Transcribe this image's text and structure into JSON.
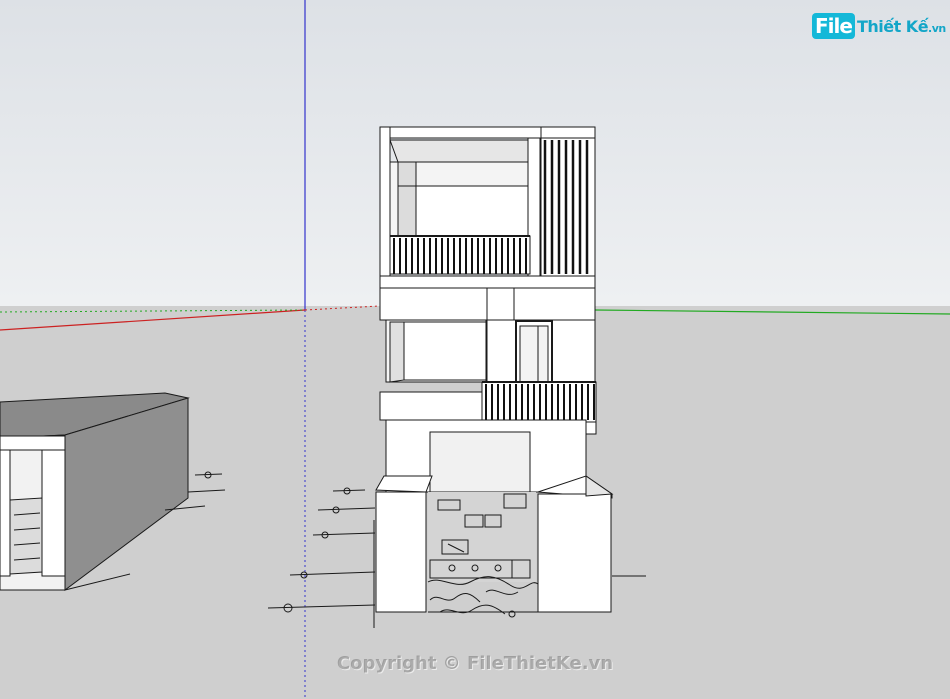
{
  "logo": {
    "prefix": "File",
    "name": "Thiết Kế",
    "suffix": ".vn"
  },
  "watermark": {
    "text": "Copyright © FileThietKe.vn"
  },
  "colors": {
    "sky_top": "#dde1e6",
    "sky_bottom": "#eef0f2",
    "ground": "#cfcfcf",
    "axis_red": "#cc2222",
    "axis_green": "#22aa22",
    "axis_blue": "#3333cc",
    "logo_accent": "#14b8d8"
  }
}
